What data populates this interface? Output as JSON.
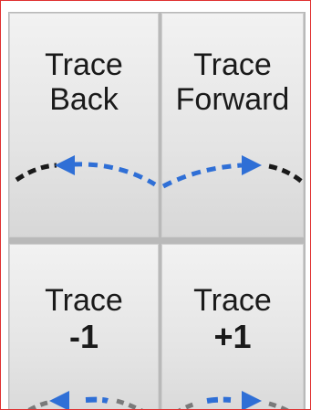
{
  "buttons": {
    "trace_back": {
      "line1": "Trace",
      "line2": "Back"
    },
    "trace_forward": {
      "line1": "Trace",
      "line2": "Forward"
    },
    "trace_minus1": {
      "line1": "Trace",
      "line2": "-1"
    },
    "trace_plus1": {
      "line1": "Trace",
      "line2": "+1"
    }
  },
  "colors": {
    "arrow_blue": "#2f6fd6",
    "dash_black": "#1a1a1a",
    "dash_gray": "#7a7a7a",
    "frame_border": "#e03030"
  },
  "icons": {
    "trace_back": "arrow-left-icon",
    "trace_forward": "arrow-right-icon",
    "trace_minus1": "arrow-left-icon",
    "trace_plus1": "arrow-right-icon"
  }
}
